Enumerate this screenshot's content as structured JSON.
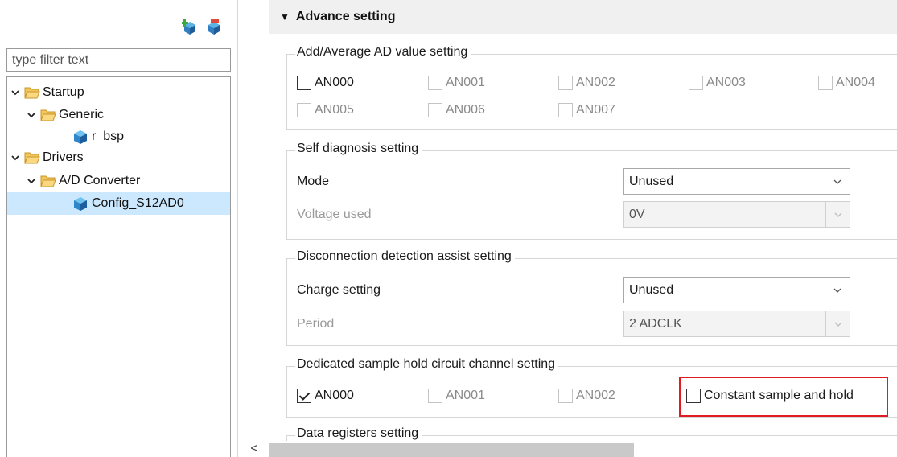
{
  "toolbar": {
    "icons": [
      "add-component-icon",
      "remove-component-icon"
    ]
  },
  "filter": {
    "placeholder": "type filter text"
  },
  "tree": {
    "startup": "Startup",
    "generic": "Generic",
    "r_bsp": "r_bsp",
    "drivers": "Drivers",
    "ad_converter": "A/D Converter",
    "config": "Config_S12AD0"
  },
  "advance": {
    "title": "Advance setting"
  },
  "add_avg": {
    "title": "Add/Average AD value setting",
    "channels": [
      "AN000",
      "AN001",
      "AN002",
      "AN003",
      "AN004",
      "AN005",
      "AN006",
      "AN007"
    ]
  },
  "self_diag": {
    "title": "Self diagnosis setting",
    "mode_label": "Mode",
    "mode_value": "Unused",
    "voltage_label": "Voltage used",
    "voltage_value": "0V"
  },
  "disconnect": {
    "title": "Disconnection detection assist setting",
    "charge_label": "Charge setting",
    "charge_value": "Unused",
    "period_label": "Period",
    "period_value": "2 ADCLK"
  },
  "sample_hold": {
    "title": "Dedicated sample hold circuit channel setting",
    "channels": [
      "AN000",
      "AN001",
      "AN002"
    ],
    "constant_label": "Constant sample and hold"
  },
  "data_reg": {
    "title": "Data registers setting"
  },
  "colors": {
    "selection": "#cce8ff",
    "highlight": "#e11b22",
    "header_bg": "#f0f0f0"
  }
}
